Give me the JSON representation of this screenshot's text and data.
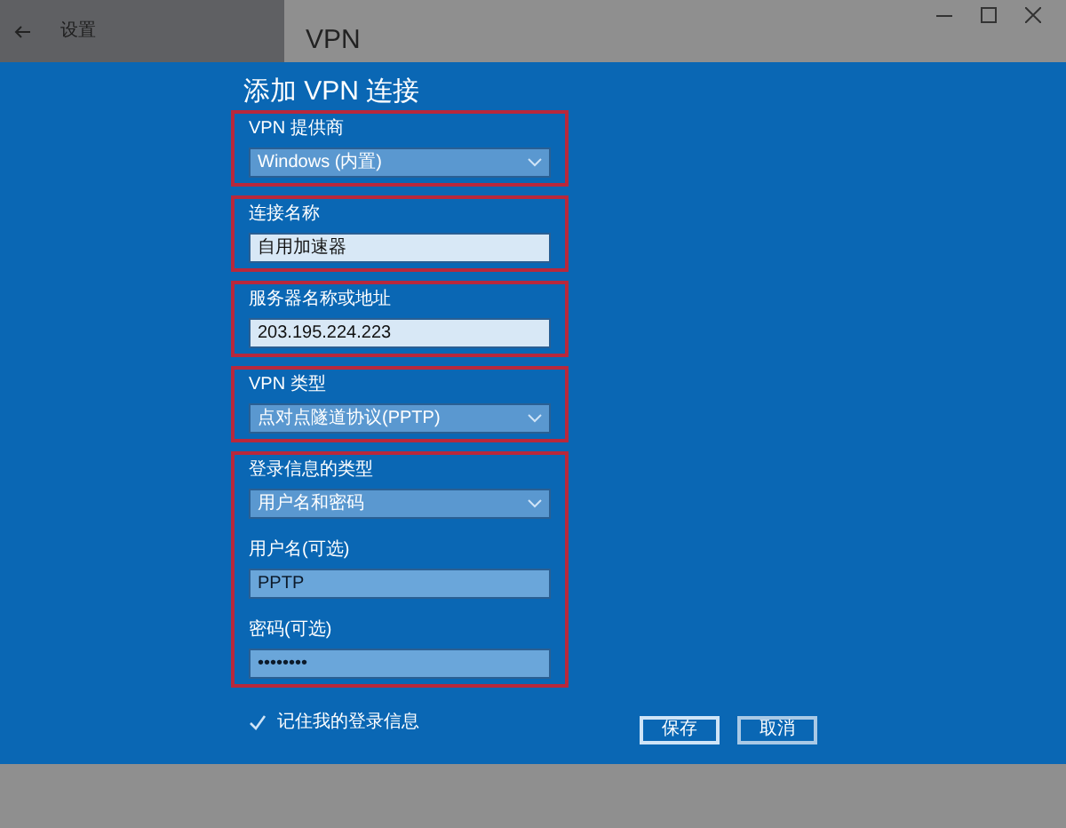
{
  "settings_window": {
    "title": "设置",
    "page_heading": "VPN"
  },
  "dialog": {
    "title": "添加 VPN 连接",
    "groups": [
      {
        "fields": [
          {
            "kind": "dropdown",
            "label": "VPN 提供商",
            "value": "Windows (内置)"
          }
        ]
      },
      {
        "fields": [
          {
            "kind": "text",
            "label": "连接名称",
            "value": "自用加速器",
            "highlighted": true
          }
        ]
      },
      {
        "fields": [
          {
            "kind": "text",
            "label": "服务器名称或地址",
            "value": "203.195.224.223",
            "highlighted": true
          }
        ]
      },
      {
        "fields": [
          {
            "kind": "dropdown",
            "label": "VPN 类型",
            "value": "点对点隧道协议(PPTP)"
          }
        ]
      },
      {
        "fields": [
          {
            "kind": "dropdown",
            "label": "登录信息的类型",
            "value": "用户名和密码"
          },
          {
            "kind": "text",
            "label": "用户名(可选)",
            "value": "PPTP",
            "highlighted": false
          },
          {
            "kind": "password",
            "label": "密码(可选)",
            "value": "••••••••",
            "highlighted": false
          }
        ]
      }
    ],
    "remember": {
      "label": "记住我的登录信息",
      "checked": true
    },
    "buttons": [
      {
        "label": "保存",
        "kind": "primary"
      },
      {
        "label": "取消",
        "kind": "secondary"
      }
    ]
  }
}
